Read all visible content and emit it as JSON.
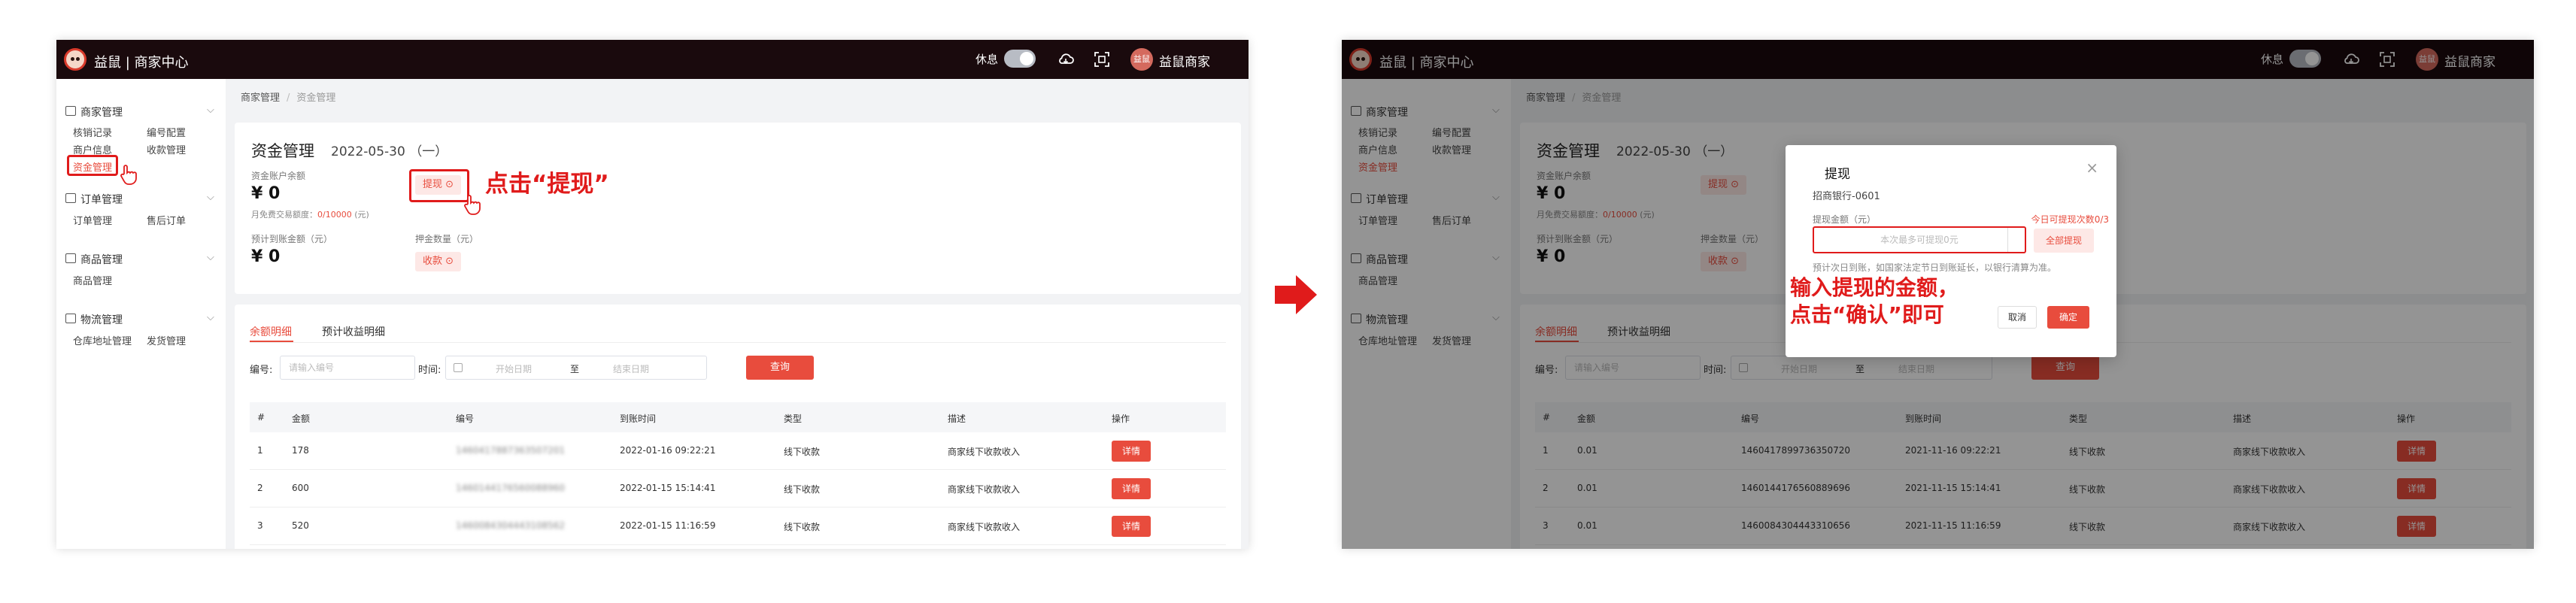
{
  "header": {
    "brand": "益鼠 | 商家中心",
    "rest_label": "休息",
    "user_name": "益鼠商家",
    "avatar_text": "益鼠"
  },
  "sidebar": {
    "groups": [
      {
        "label": "商家管理",
        "items": [
          "核销记录",
          "编号配置",
          "商户信息",
          "收款管理",
          "资金管理"
        ],
        "active": "资金管理"
      },
      {
        "label": "订单管理",
        "items": [
          "订单管理",
          "售后订单"
        ]
      },
      {
        "label": "商品管理",
        "items": [
          "商品管理"
        ]
      },
      {
        "label": "物流管理",
        "items": [
          "仓库地址管理",
          "发货管理"
        ]
      }
    ]
  },
  "breadcrumb": {
    "parent": "商家管理",
    "current": "资金管理"
  },
  "fund": {
    "title": "资金管理",
    "date": "2022-05-30 （一）",
    "balance_label": "资金账户余额",
    "balance": "¥ 0",
    "withdraw_label": "提现",
    "free_quota_prefix": "月免费交易额度：",
    "free_quota_value": "0/10000",
    "free_quota_suffix": " (元)",
    "expected_label": "预计到账金额（元）",
    "expected": "¥ 0",
    "deposit_label": "押金数量（元）",
    "collect_label": "收款"
  },
  "tabs": [
    "余额明细",
    "预计收益明细"
  ],
  "filters": {
    "code_label": "编号:",
    "code_placeholder": "请输入编号",
    "time_label": "时间:",
    "start_placeholder": "开始日期",
    "to": "至",
    "end_placeholder": "结束日期",
    "query_label": "查询"
  },
  "table": {
    "headers": [
      "#",
      "金额",
      "编号",
      "到账时间",
      "类型",
      "描述",
      "操作"
    ],
    "rows_left": [
      {
        "idx": "1",
        "amount": "178",
        "code": "1460417887363507201",
        "time": "2022-01-16 09:22:21",
        "type": "线下收款",
        "desc": "商家线下收款收入"
      },
      {
        "idx": "2",
        "amount": "600",
        "code": "1460144176560088960",
        "time": "2022-01-15 15:14:41",
        "type": "线下收款",
        "desc": "商家线下收款收入"
      },
      {
        "idx": "3",
        "amount": "520",
        "code": "1460084304443108562",
        "time": "2022-01-15 11:16:59",
        "type": "线下收款",
        "desc": "商家线下收款收入"
      }
    ],
    "rows_right": [
      {
        "idx": "1",
        "amount": "0.01",
        "code": "1460417899736350720",
        "time": "2021-11-16 09:22:21",
        "type": "线下收款",
        "desc": "商家线下收款收入"
      },
      {
        "idx": "2",
        "amount": "0.01",
        "code": "1460144176560889696",
        "time": "2021-11-15 15:14:41",
        "type": "线下收款",
        "desc": "商家线下收款收入"
      },
      {
        "idx": "3",
        "amount": "0.01",
        "code": "1460084304443310656",
        "time": "2021-11-15 11:16:59",
        "type": "线下收款",
        "desc": "商家线下收款收入"
      }
    ],
    "detail_label": "详情"
  },
  "dialog": {
    "title": "提现",
    "bank": "招商银行-0601",
    "amount_label": "提现金额（元）",
    "today_prefix": "今日可提现次数",
    "today_value": "0/3",
    "input_placeholder": "本次最多可提现0元",
    "all_label": "全部提现",
    "note": "预计次日到账，如国家法定节日到账延长，以银行清算为准。",
    "cancel_label": "取消",
    "ok_label": "确定"
  },
  "annotations": {
    "left_callout": "点击“提现”",
    "right_callout_line1": "输入提现的金额，",
    "right_callout_line2": "点击“确认”即可"
  },
  "colors": {
    "accent": "#e84c3d",
    "highlight": "#e01b1b",
    "topbar": "#1a0a0d"
  }
}
